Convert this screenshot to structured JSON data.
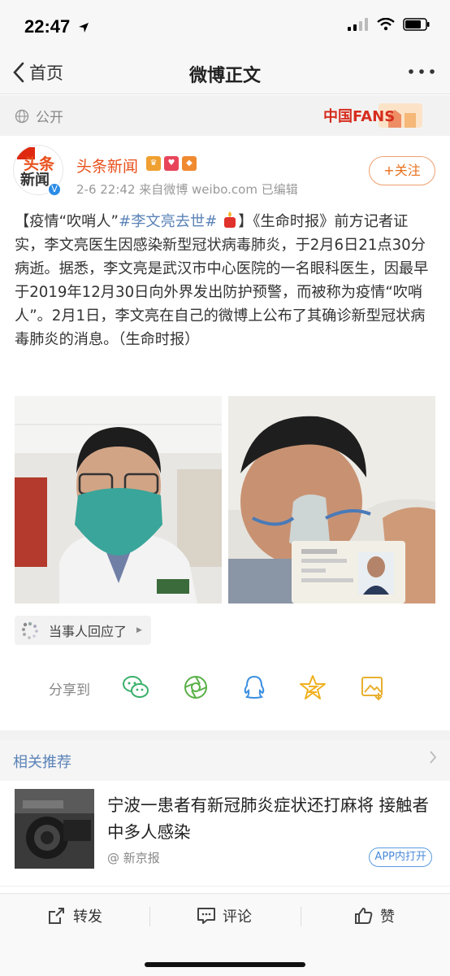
{
  "status_bar": {
    "time": "22:47"
  },
  "nav": {
    "back_label": "首页",
    "title": "微博正文"
  },
  "visibility": {
    "label": "公开",
    "fans_badge_text": "中国FANS"
  },
  "author": {
    "avatar_text_top": "头条",
    "avatar_text_bottom": "新闻",
    "name": "头条新闻",
    "meta": "2-6 22:42  来自微博 weibo.com  已编辑",
    "follow_label": "+关注",
    "badge_colors": [
      "#f0a030",
      "#e8455a",
      "#f08a30"
    ]
  },
  "post": {
    "prefix": "【疫情“吹哨人”",
    "topic": "#李文亮去世#",
    "after_topic": "】《生命时报》前方记者证实，李文亮医生因感染新型冠状病毒肺炎，于2月6日21点30分病逝。据悉，李文亮是武汉市中心医院的一名眼科医生，因最早于2019年12月30日向外界发出防护预警，而被称为疫情“吹哨人”。2月1日，李文亮在自己的微博上公布了其确诊新型冠状病毒肺炎的消息。（生命时报）"
  },
  "reply": {
    "label": "当事人回应了"
  },
  "share": {
    "label": "分享到",
    "targets": [
      "wechat-icon",
      "moments-icon",
      "qq-icon",
      "qzone-icon",
      "save-image-icon"
    ]
  },
  "related": {
    "title": "相关推荐",
    "item": {
      "title": "宁波一患者有新冠肺炎症状还打麻将 接触者中多人感染",
      "source": "新京报",
      "app_button": "APP内打开"
    }
  },
  "actions": {
    "repost": "转发",
    "comment": "评论",
    "like": "赞"
  },
  "colors": {
    "accent_orange": "#e8501c",
    "link_blue": "#5b83b8",
    "verified_blue": "#2b8ce6"
  }
}
